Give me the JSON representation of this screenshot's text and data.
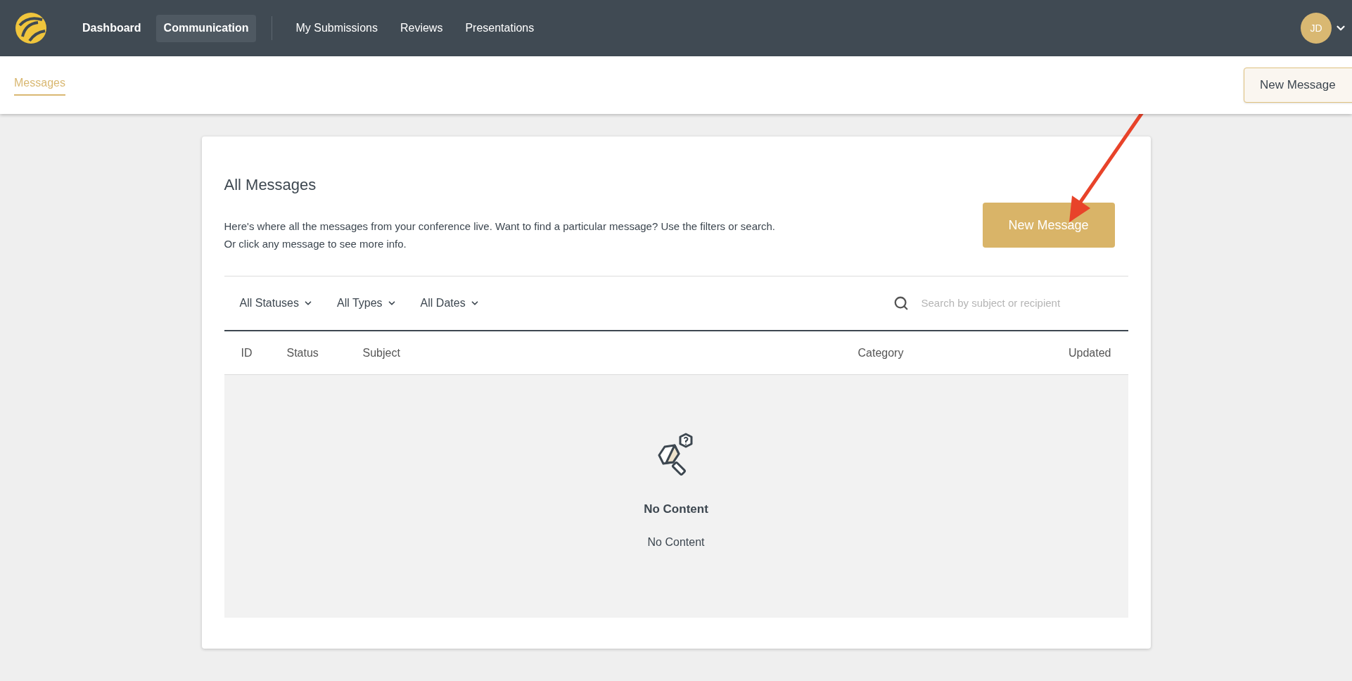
{
  "nav": {
    "items": [
      {
        "label": "Dashboard",
        "selected": false
      },
      {
        "label": "Communication",
        "selected": true
      },
      {
        "label": "My Submissions",
        "selected": false
      },
      {
        "label": "Reviews",
        "selected": false
      },
      {
        "label": "Presentations",
        "selected": false
      }
    ],
    "avatar": "JD"
  },
  "subnav": {
    "tabs": [
      {
        "label": "Messages",
        "selected": true
      }
    ],
    "button": "New Message"
  },
  "card": {
    "title": "All Messages",
    "description": "Here's where all the messages from your conference live. Want to find a particular message? Use the filters or search. Or click any message to see more info.",
    "button": "New Message",
    "filters": [
      "All Statuses",
      "All Types",
      "All Dates"
    ],
    "search": {
      "placeholder": "Search by subject or recipient"
    },
    "table": {
      "columns": [
        "ID",
        "Status",
        "Subject",
        "Category",
        "Updated"
      ]
    },
    "empty": {
      "title": "No Content",
      "text": "No Content"
    }
  }
}
